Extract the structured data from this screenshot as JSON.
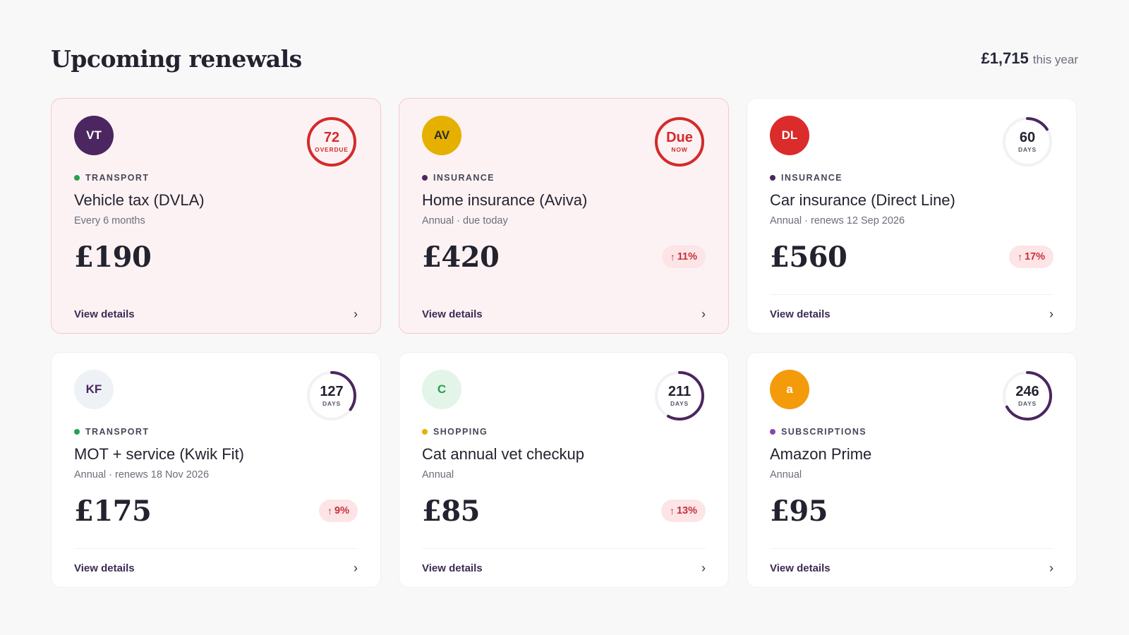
{
  "header": {
    "title": "Upcoming renewals",
    "total_amount": "£1,715",
    "total_label": "this year"
  },
  "cards": [
    {
      "initials": "VT",
      "avatar_bg": "#4b2660",
      "avatar_fg": "#ffffff",
      "ring_num": "72",
      "ring_unit": "OVERDUE",
      "ring_fraction": 1.0,
      "ring_color": "#d42a2a",
      "category": "TRANSPORT",
      "dot_color": "#22a34a",
      "name": "Vehicle tax (DVLA)",
      "sub": "Every 6 months",
      "price": "£190",
      "change": "",
      "link": "View details",
      "alert": true
    },
    {
      "initials": "AV",
      "avatar_bg": "#e5b000",
      "avatar_fg": "#2a2a2a",
      "ring_num": "Due",
      "ring_unit": "NOW",
      "ring_fraction": 1.0,
      "ring_color": "#d42a2a",
      "category": "INSURANCE",
      "dot_color": "#4b2660",
      "name": "Home insurance (Aviva)",
      "sub": "Annual · due today",
      "price": "£420",
      "change": "11%",
      "link": "View details",
      "alert": true
    },
    {
      "initials": "DL",
      "avatar_bg": "#db2b2b",
      "avatar_fg": "#ffffff",
      "ring_num": "60",
      "ring_unit": "DAYS",
      "ring_fraction": 0.16,
      "ring_color": "#4b2660",
      "category": "INSURANCE",
      "dot_color": "#4b2660",
      "name": "Car insurance (Direct Line)",
      "sub": "Annual · renews 12 Sep 2026",
      "price": "£560",
      "change": "17%",
      "link": "View details",
      "alert": false
    },
    {
      "initials": "KF",
      "avatar_bg": "#eef1f6",
      "avatar_fg": "#4b2660",
      "ring_num": "127",
      "ring_unit": "DAYS",
      "ring_fraction": 0.35,
      "ring_color": "#4b2660",
      "category": "TRANSPORT",
      "dot_color": "#22a34a",
      "name": "MOT + service (Kwik Fit)",
      "sub": "Annual · renews 18 Nov 2026",
      "price": "£175",
      "change": "9%",
      "link": "View details",
      "alert": false
    },
    {
      "initials": "C",
      "avatar_bg": "#e3f4e8",
      "avatar_fg": "#22a34a",
      "ring_num": "211",
      "ring_unit": "DAYS",
      "ring_fraction": 0.58,
      "ring_color": "#4b2660",
      "category": "SHOPPING",
      "dot_color": "#e5b000",
      "name": "Cat annual vet checkup",
      "sub": "Annual",
      "price": "£85",
      "change": "13%",
      "link": "View details",
      "alert": false
    },
    {
      "initials": "a",
      "avatar_bg": "#f49b0b",
      "avatar_fg": "#ffffff",
      "ring_num": "246",
      "ring_unit": "DAYS",
      "ring_fraction": 0.67,
      "ring_color": "#4b2660",
      "category": "SUBSCRIPTIONS",
      "dot_color": "#8e44ad",
      "name": "Amazon Prime",
      "sub": "Annual",
      "price": "£95",
      "change": "",
      "link": "View details",
      "alert": false
    }
  ]
}
